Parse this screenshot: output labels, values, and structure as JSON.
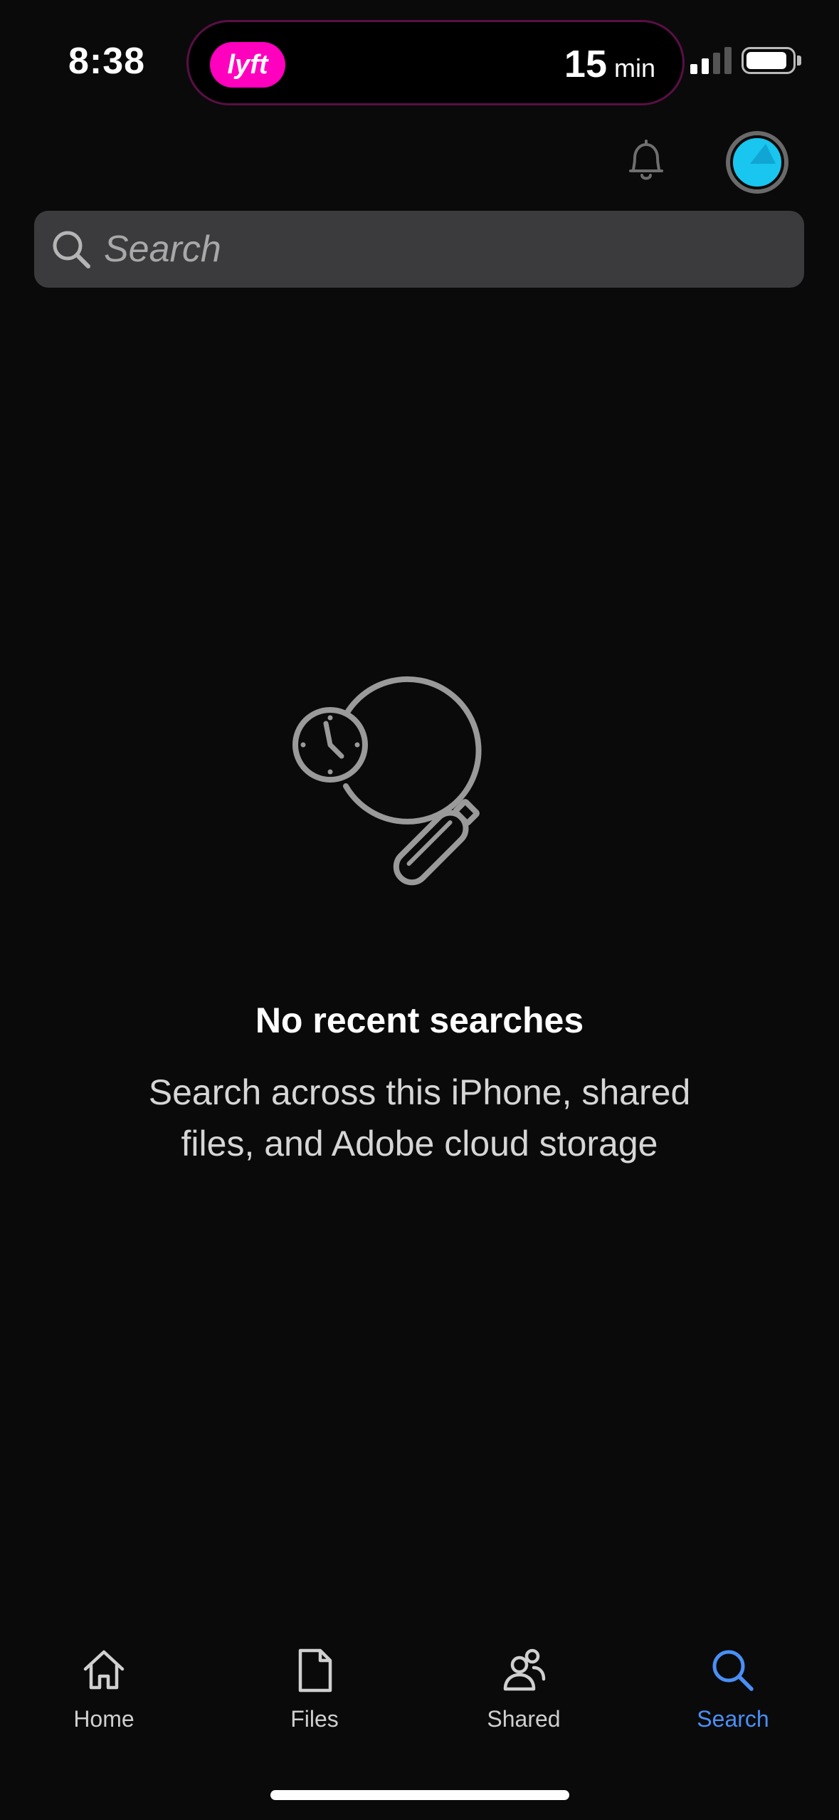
{
  "status_bar": {
    "time": "8:38",
    "live_activity": {
      "app_badge": "lyft",
      "eta_value": "15",
      "eta_unit": "min",
      "badge_color": "#ff00bf"
    },
    "signal_bars_active": 2,
    "signal_bars_total": 4,
    "battery_level": 0.9
  },
  "header": {
    "notifications_icon": "bell-icon",
    "avatar_color": "#18c6ef"
  },
  "search": {
    "placeholder": "Search",
    "value": ""
  },
  "empty_state": {
    "icon": "recent-search-magnifier-clock-icon",
    "title": "No recent searches",
    "description": "Search across this iPhone, shared files, and Adobe cloud storage"
  },
  "tabs": [
    {
      "label": "Home",
      "icon": "home-icon",
      "active": false
    },
    {
      "label": "Files",
      "icon": "file-icon",
      "active": false
    },
    {
      "label": "Shared",
      "icon": "people-icon",
      "active": false
    },
    {
      "label": "Search",
      "icon": "search-icon",
      "active": true
    }
  ],
  "colors": {
    "background": "#0a0a0a",
    "accent": "#4a8ff5",
    "search_field": "#3b3b3d"
  }
}
